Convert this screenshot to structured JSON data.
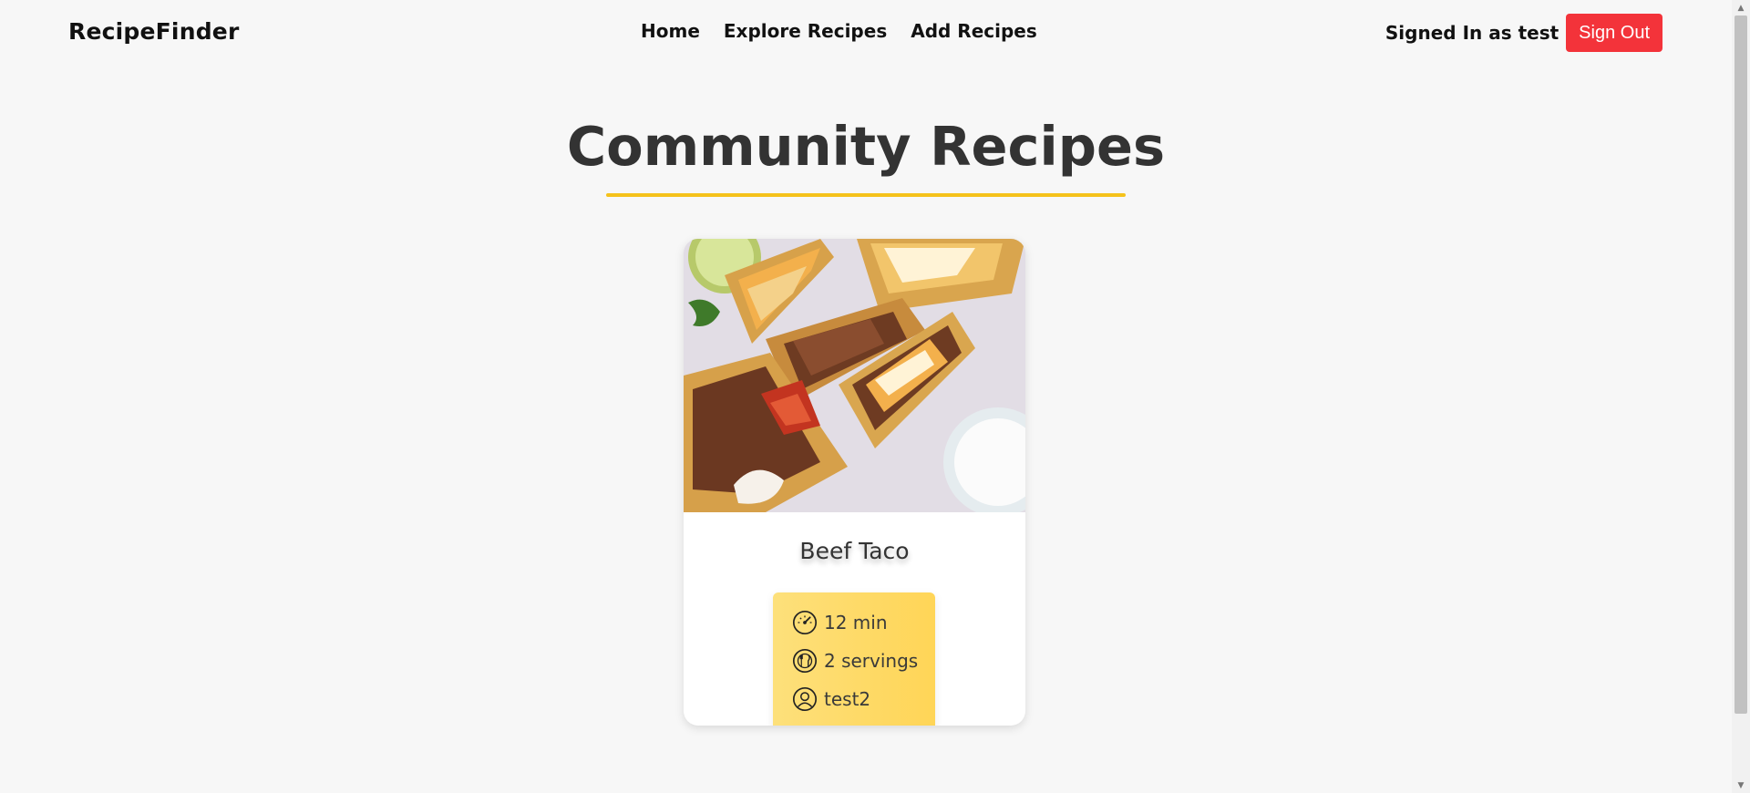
{
  "nav": {
    "brand": "RecipeFinder",
    "links": [
      "Home",
      "Explore Recipes",
      "Add Recipes"
    ],
    "signed_in_text": "Signed In as test",
    "sign_out_label": "Sign Out",
    "sign_out_color": "#f3333a"
  },
  "page": {
    "title": "Community Recipes",
    "accent_color": "#f5c21b"
  },
  "recipes": [
    {
      "title": "Beef Taco",
      "image_icon": "beef-taco-photo",
      "time": "12 min",
      "servings": "2 servings",
      "author": "test2"
    }
  ],
  "icons": {
    "time": "speedometer-icon",
    "servings": "plate-cutlery-icon",
    "author": "user-icon"
  }
}
